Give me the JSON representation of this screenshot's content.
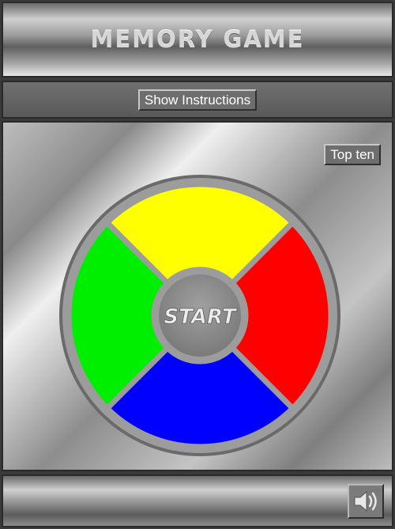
{
  "header": {
    "title": "MEMORY GAME"
  },
  "toolbar": {
    "show_instructions_label": "Show Instructions"
  },
  "main": {
    "top_ten_label": "Top ten"
  },
  "board": {
    "start_label": "START",
    "colors": {
      "top": "#ffff00",
      "right": "#ff0000",
      "bottom": "#0000ff",
      "left": "#00ee00",
      "center": "#8a8a8a",
      "ring": "#9c9c9c"
    }
  },
  "footer": {
    "sound_icon": "speaker-volume-icon"
  }
}
